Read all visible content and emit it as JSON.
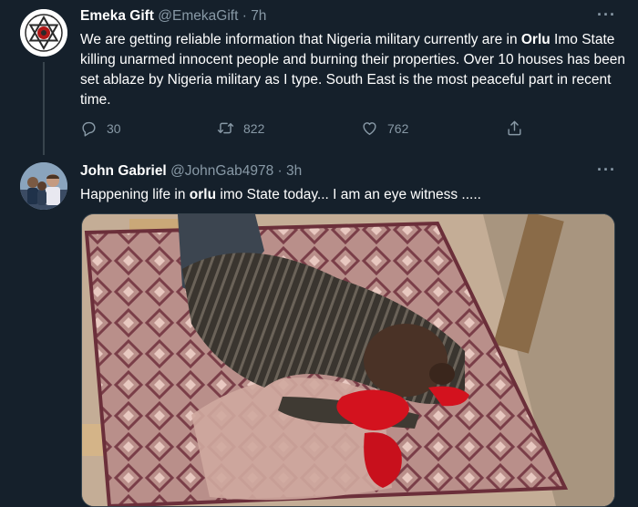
{
  "tweet1": {
    "name": "Emeka Gift",
    "handle": "@EmekaGift",
    "separator": "·",
    "time": "7h",
    "more": "···",
    "text_before": "We are getting reliable information that Nigeria military currently are in ",
    "text_bold": "Orlu",
    "text_after": " Imo State killing unarmed innocent people and burning their properties. Over 10 houses has been set ablaze by Nigeria military as I type. South East is the most  peaceful part in recent time.",
    "reply_count": "30",
    "retweet_count": "822",
    "like_count": "762",
    "avatar_icon": "hexagram-logo-icon"
  },
  "tweet2": {
    "name": "John Gabriel",
    "handle": "@JohnGab4978",
    "separator": "·",
    "time": "3h",
    "more": "···",
    "text_before": "Happening life in ",
    "text_bold": "orlu",
    "text_after": " imo State  today... I am an eye witness .....",
    "avatar_icon": "group-photo-avatar"
  },
  "icons": {
    "reply": "reply-icon",
    "retweet": "retweet-icon",
    "like": "heart-icon",
    "share": "share-icon"
  },
  "colors": {
    "background": "#15202b",
    "text": "#ffffff",
    "secondary": "#8899a6",
    "divider": "#38444d"
  }
}
